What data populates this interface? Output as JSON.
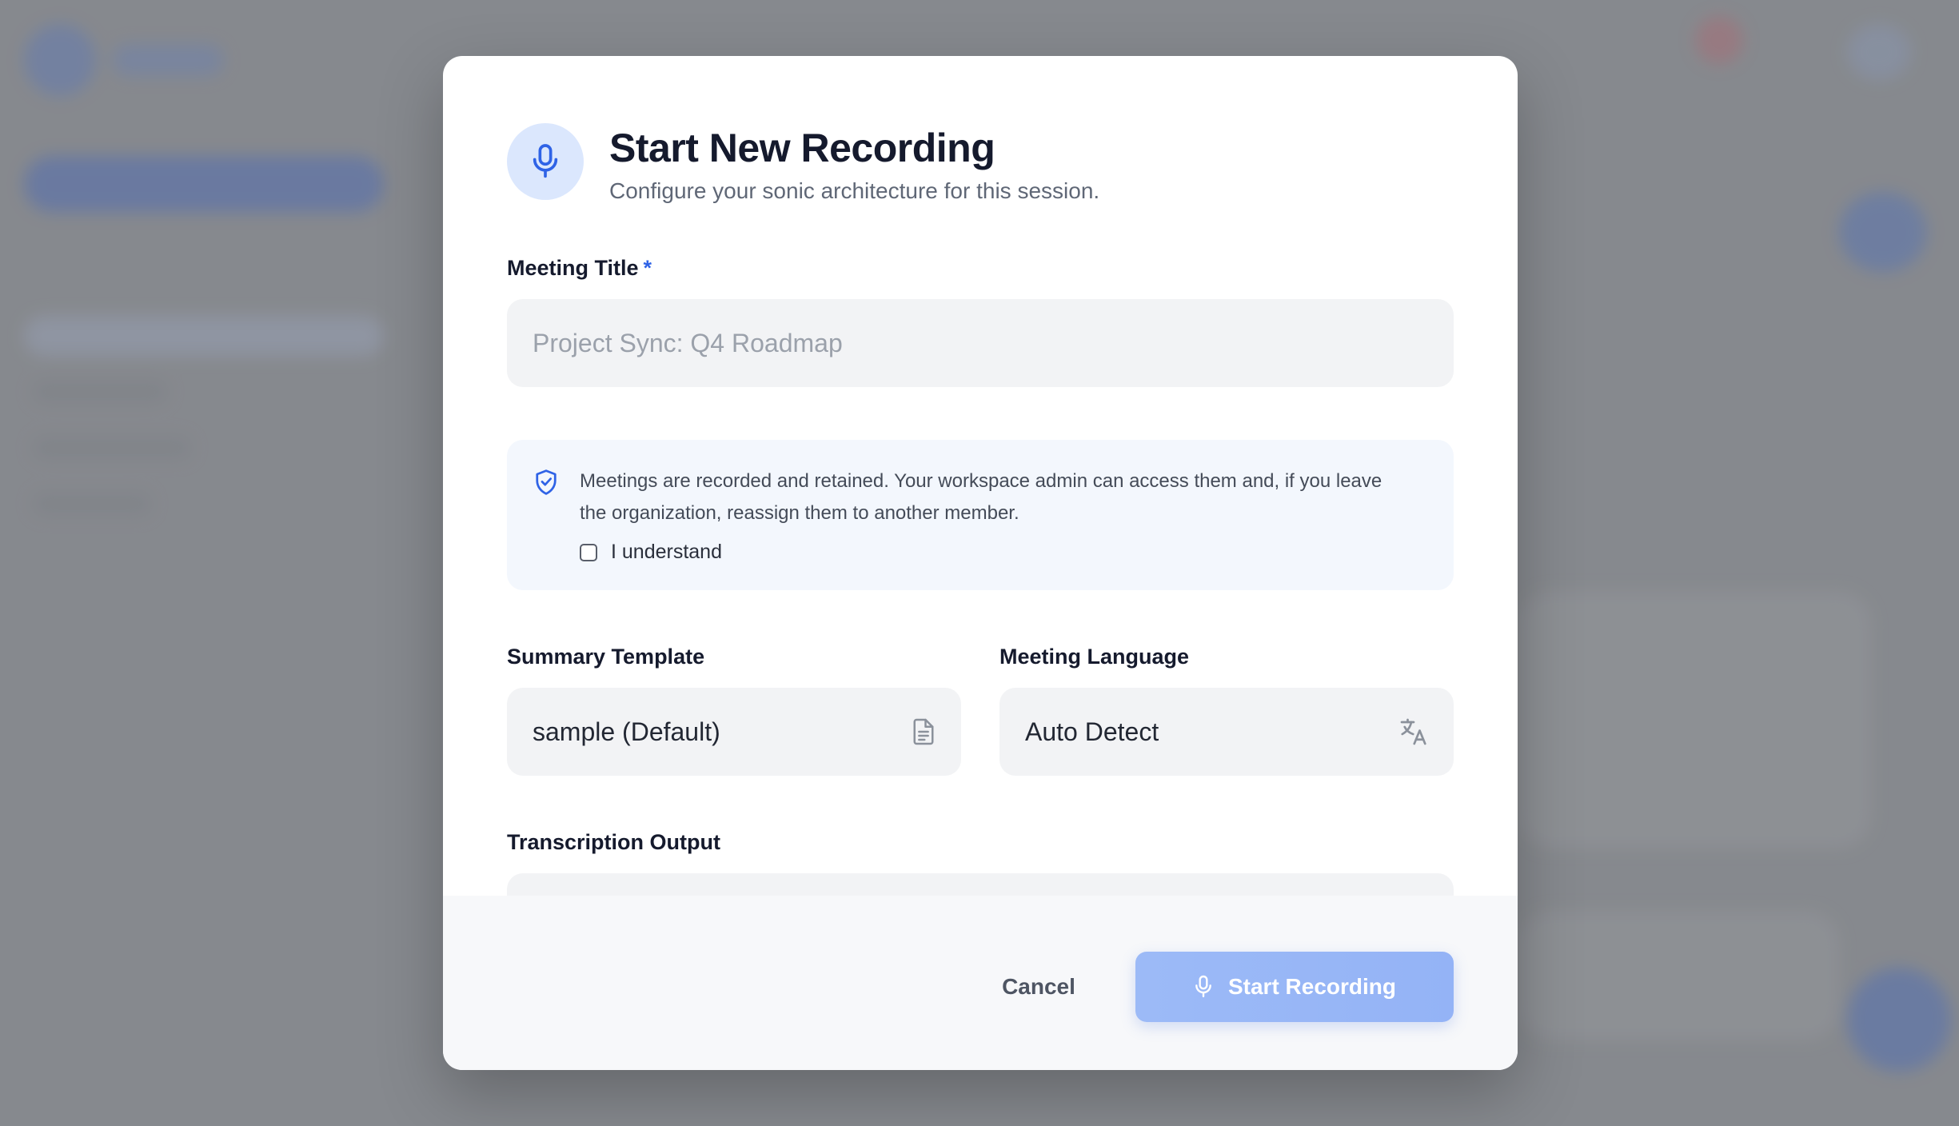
{
  "modal": {
    "title": "Start New Recording",
    "subtitle": "Configure your sonic architecture for this session.",
    "header_icon": "microphone-icon"
  },
  "meeting_title": {
    "label": "Meeting Title",
    "required_mark": "*",
    "value": "",
    "placeholder": "Project Sync: Q4 Roadmap"
  },
  "notice": {
    "icon": "shield-check-icon",
    "text": "Meetings are recorded and retained. Your workspace admin can access them and, if you leave the organization, reassign them to another member.",
    "ack_label": "I understand",
    "ack_checked": false
  },
  "summary_template": {
    "label": "Summary Template",
    "value": "sample (Default)",
    "icon": "document-icon"
  },
  "meeting_language": {
    "label": "Meeting Language",
    "value": "Auto Detect",
    "icon": "translate-icon"
  },
  "transcription_output": {
    "label": "Transcription Output"
  },
  "footer": {
    "cancel_label": "Cancel",
    "start_label": "Start Recording"
  },
  "colors": {
    "accent": "#2f63e6",
    "primary_disabled": "#9cbaf7",
    "field_bg": "#f2f3f5",
    "notice_bg": "#f3f7fd"
  }
}
